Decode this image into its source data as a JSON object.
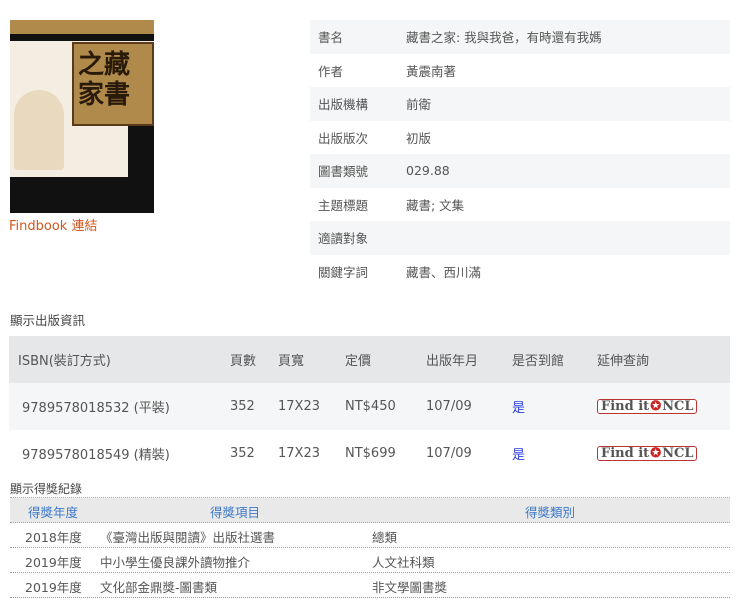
{
  "cover": {
    "title": "藏書之家",
    "alt": "book-cover"
  },
  "findbook_link": "Findbook 連結",
  "info": [
    {
      "label": "書名",
      "value": "藏書之家: 我與我爸，有時還有我媽"
    },
    {
      "label": "作者",
      "value": "黃震南著"
    },
    {
      "label": "出版機構",
      "value": "前衛"
    },
    {
      "label": "出版版次",
      "value": "初版"
    },
    {
      "label": "圖書類號",
      "value": "029.88"
    },
    {
      "label": "主題標題",
      "value": "藏書; 文集"
    },
    {
      "label": "適讀對象",
      "value": ""
    },
    {
      "label": "關鍵字詞",
      "value": "藏書、西川滿"
    }
  ],
  "publication": {
    "title": "顯示出版資訊",
    "headers": [
      "ISBN(裝訂方式)",
      "頁數",
      "頁寬",
      "定價",
      "出版年月",
      "是否到館",
      "延伸查詢"
    ],
    "rows": [
      {
        "isbn": "9789578018532 (平裝)",
        "pages": "352",
        "size": "17X23",
        "price": "NT$450",
        "date": "107/09",
        "available": "是",
        "link": "Find it",
        "link2": "NCL"
      },
      {
        "isbn": "9789578018549 (精裝)",
        "pages": "352",
        "size": "17X23",
        "price": "NT$699",
        "date": "107/09",
        "available": "是",
        "link": "Find it",
        "link2": "NCL"
      }
    ]
  },
  "awards": {
    "title": "顯示得獎紀錄",
    "headers": [
      "得獎年度",
      "得獎項目",
      "得獎類別"
    ],
    "rows": [
      {
        "year": "2018年度",
        "item": "《臺灣出版與閱讀》出版社選書",
        "category": "總類"
      },
      {
        "year": "2019年度",
        "item": "中小學生優良課外讀物推介",
        "category": "人文社科類"
      },
      {
        "year": "2019年度",
        "item": "文化部金鼎獎-圖書類",
        "category": "非文學圖書獎"
      }
    ]
  }
}
